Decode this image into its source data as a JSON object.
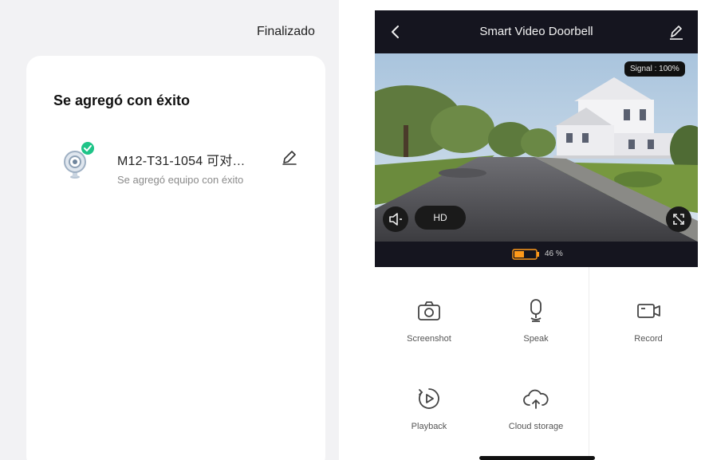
{
  "left": {
    "done_label": "Finalizado",
    "title": "Se agregó con éxito",
    "device": {
      "name": "M12-T31-1054 可对…",
      "status": "Se agregó equipo con éxito",
      "icon": "camera-icon",
      "badge_icon": "check-circle-icon"
    }
  },
  "right": {
    "header": {
      "title": "Smart Video Doorbell",
      "back_icon": "chevron-left-icon",
      "edit_icon": "pen-icon"
    },
    "video": {
      "signal": "Signal : 100%",
      "quality": "HD",
      "mute_icon": "speaker-icon",
      "fullscreen_icon": "fullscreen-icon"
    },
    "battery": {
      "text": "46 %",
      "level": 0.46
    },
    "controls": [
      {
        "label": "Screenshot",
        "icon": "camera-icon"
      },
      {
        "label": "Speak",
        "icon": "microphone-icon"
      },
      {
        "label": "Record",
        "icon": "video-camera-icon"
      },
      {
        "label": "Playback",
        "icon": "playback-icon"
      },
      {
        "label": "Cloud storage",
        "icon": "cloud-upload-icon"
      }
    ],
    "colors": {
      "bar": "#15151f",
      "accent_green": "#1fc488",
      "battery_orange": "#ff9a1a"
    }
  }
}
